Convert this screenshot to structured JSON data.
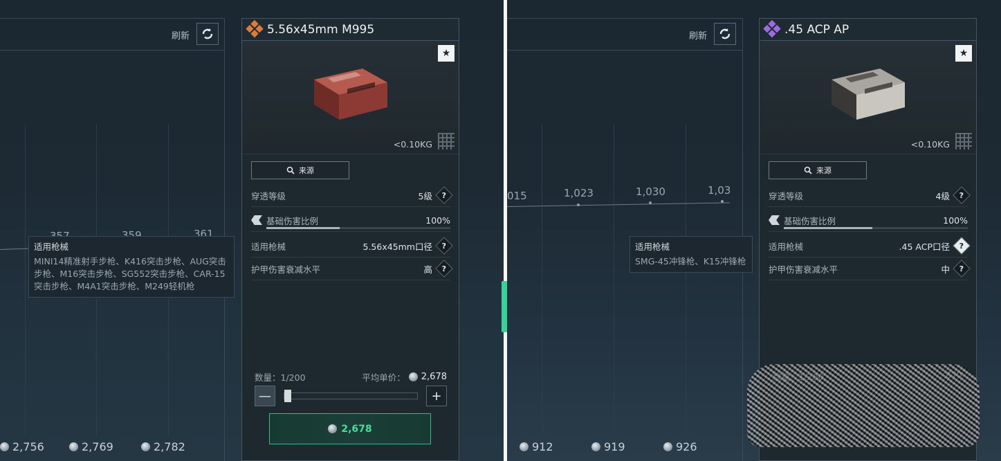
{
  "left": {
    "market": {
      "refresh_label": "刷新",
      "chart_values": [
        "357",
        "359",
        "361"
      ],
      "bottom_prices": [
        "2,756",
        "2,769",
        "2,782"
      ]
    },
    "tooltip": {
      "title": "适用枪械",
      "body": "MINI14精准射手步枪、K416突击步枪、AUG突击步枪、M16突击步枪、SG552突击步枪、CAR-15突击步枪、M4A1突击步枪、M249轻机枪"
    },
    "item": {
      "name": "5.56x45mm M995",
      "rarity_color": "#e07a3a",
      "favorite_icon": "star-icon",
      "weight": "<0.10KG",
      "source_label": "来源",
      "stats": {
        "penetration_label": "穿透等级",
        "penetration_value": "5级",
        "damage_label": "基础伤害比例",
        "damage_value": "100%",
        "damage_fill": 0.4,
        "weapon_label": "适用枪械",
        "weapon_value": "5.56x45mm口径",
        "armor_label": "护甲伤害衰减水平",
        "armor_value": "高"
      },
      "quantity_label": "数量：1/200",
      "avg_price_label": "平均单价：",
      "avg_price": "2,678",
      "buy_price": "2,678"
    }
  },
  "right": {
    "market": {
      "refresh_label": "刷新",
      "chart_values": [
        "015",
        "1,023",
        "1,030",
        "1,03"
      ],
      "bottom_prices": [
        "912",
        "919",
        "926"
      ]
    },
    "tooltip": {
      "title": "适用枪械",
      "body": "SMG-45冲锋枪、K15冲锋枪"
    },
    "item": {
      "name": ".45 ACP AP",
      "rarity_color": "#9b6be0",
      "favorite_icon": "star-icon",
      "weight": "<0.10KG",
      "source_label": "来源",
      "stats": {
        "penetration_label": "穿透等级",
        "penetration_value": "4级",
        "damage_label": "基础伤害比例",
        "damage_value": "100%",
        "damage_fill": 0.48,
        "weapon_label": "适用枪械",
        "weapon_value": ".45 ACP口径",
        "armor_label": "护甲伤害衰减水平",
        "armor_value": "中"
      },
      "quantity_label": "数量：1/200",
      "avg_price": "870"
    }
  }
}
